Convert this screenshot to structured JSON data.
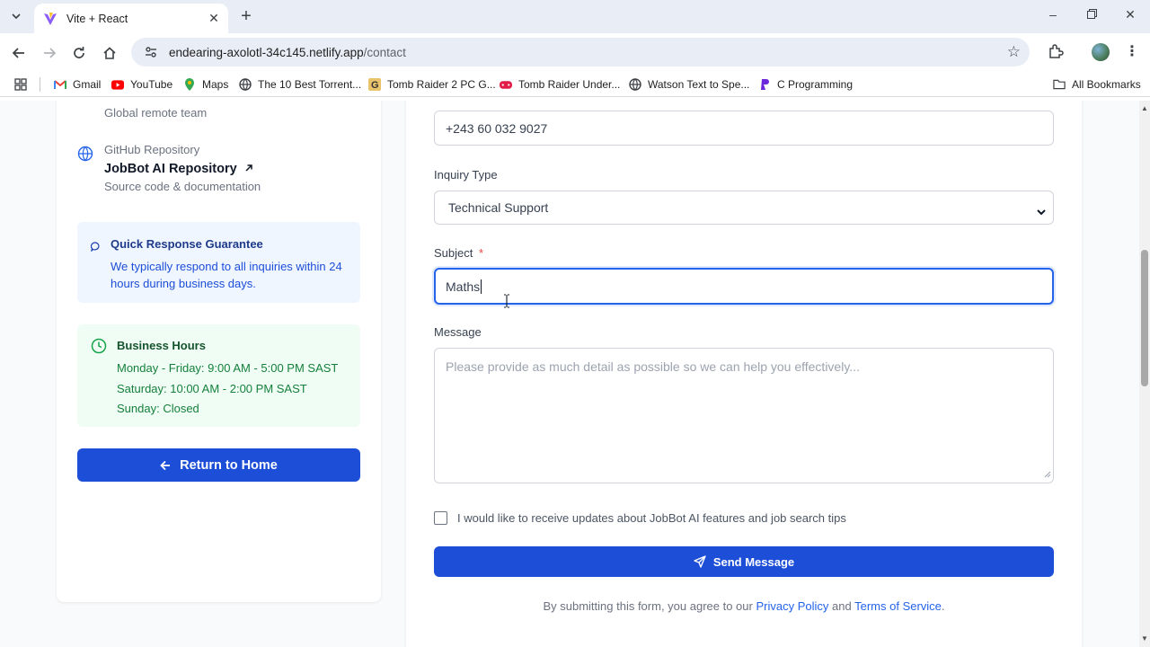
{
  "browser": {
    "tab_title": "Vite + React",
    "url_host": "endearing-axolotl-34c145.netlify.app",
    "url_path": "/contact",
    "bookmarks": [
      {
        "label": "Gmail",
        "icon": "gmail-icon"
      },
      {
        "label": "YouTube",
        "icon": "youtube-icon"
      },
      {
        "label": "Maps",
        "icon": "maps-icon"
      },
      {
        "label": "The 10 Best Torrent...",
        "icon": "globe-icon"
      },
      {
        "label": "Tomb Raider 2 PC G...",
        "icon": "g-icon"
      },
      {
        "label": "Tomb Raider Under...",
        "icon": "gamepad-icon"
      },
      {
        "label": "Watson Text to Spe...",
        "icon": "globe-icon"
      },
      {
        "label": "C Programming",
        "icon": "c-icon"
      }
    ],
    "all_bookmarks": "All Bookmarks"
  },
  "sidebar": {
    "team_note": "Global remote team",
    "github_label": "GitHub Repository",
    "github_title": "JobBot AI Repository",
    "github_sub": "Source code & documentation",
    "quick": {
      "title": "Quick Response Guarantee",
      "line1": "We typically respond to all inquiries within 24",
      "line2": "hours during business days."
    },
    "hours": {
      "title": "Business Hours",
      "weekdays": "Monday - Friday: 9:00 AM - 5:00 PM SAST",
      "saturday": "Saturday: 10:00 AM - 2:00 PM SAST",
      "sunday": "Sunday: Closed"
    },
    "return_label": "Return to Home"
  },
  "form": {
    "phone_value": "+243 60 032 9027",
    "inquiry_label": "Inquiry Type",
    "inquiry_value": "Technical Support",
    "subject_label": "Subject",
    "subject_required": "*",
    "subject_value": "Maths",
    "message_label": "Message",
    "message_placeholder": "Please provide as much detail as possible so we can help you effectively...",
    "updates_label": "I would like to receive updates about JobBot AI features and job search tips",
    "send_label": "Send Message",
    "fine_pre": "By submitting this form, you agree to our",
    "privacy": "Privacy Policy",
    "and": "and",
    "terms": "Terms of Service",
    "period": "."
  },
  "colors": {
    "primary": "#1d4ed8",
    "quick_bg": "#eff6ff",
    "hours_bg": "#f0fdf4",
    "hours_text": "#15803d",
    "quick_text": "#1e40af"
  }
}
